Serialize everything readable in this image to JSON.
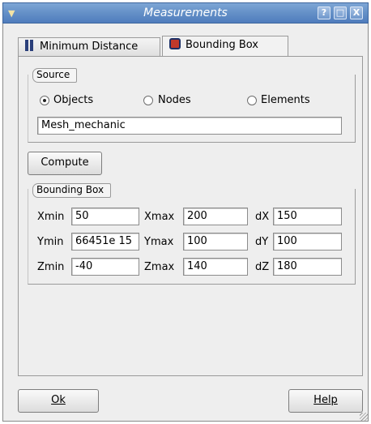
{
  "window": {
    "title": "Measurements",
    "controls": {
      "help": "?",
      "maximize": "□",
      "close": "X"
    }
  },
  "tabs": [
    {
      "label": "Minimum Distance",
      "active": false,
      "icon": "distance-icon"
    },
    {
      "label": "Bounding Box",
      "active": true,
      "icon": "bounding-box-icon"
    }
  ],
  "source": {
    "title": "Source",
    "options": [
      {
        "label": "Objects",
        "selected": true
      },
      {
        "label": "Nodes",
        "selected": false
      },
      {
        "label": "Elements",
        "selected": false
      }
    ],
    "object_name": "Mesh_mechanic"
  },
  "compute_label": "Compute",
  "bbox": {
    "title": "Bounding Box",
    "xmin_label": "Xmin",
    "xmin": "50",
    "xmax_label": "Xmax",
    "xmax": "200",
    "dx_label": "dX",
    "dx": "150",
    "ymin_label": "Ymin",
    "ymin": "66451e 15",
    "ymax_label": "Ymax",
    "ymax": "100",
    "dy_label": "dY",
    "dy": "100",
    "zmin_label": "Zmin",
    "zmin": "-40",
    "zmax_label": "Zmax",
    "zmax": "140",
    "dz_label": "dZ",
    "dz": "180"
  },
  "footer": {
    "ok_label": "Ok",
    "help_label": "Help"
  }
}
